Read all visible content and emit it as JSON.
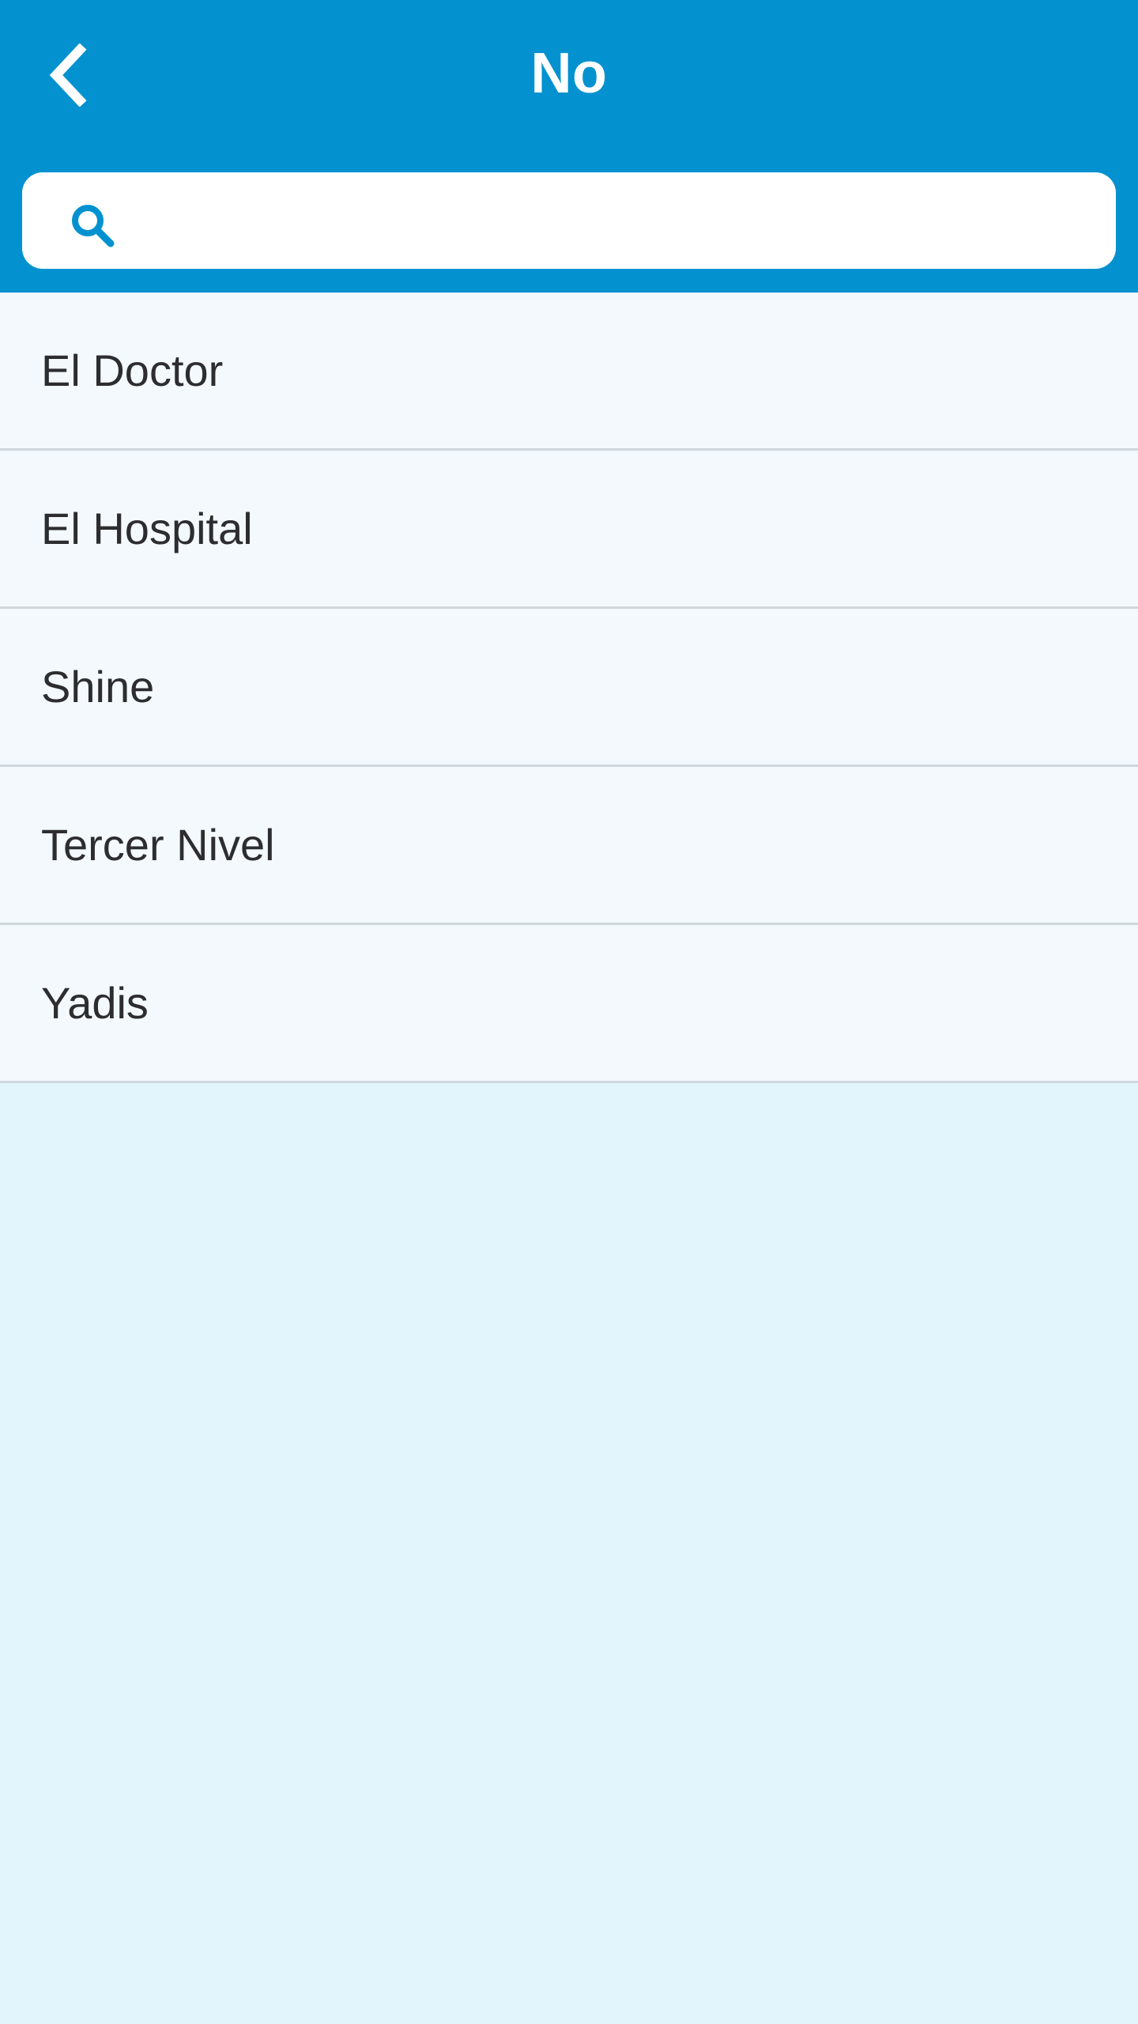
{
  "header": {
    "title": "No",
    "back_icon": "chevron-left-icon",
    "background_color": "#0392cf",
    "title_color": "#ffffff"
  },
  "search": {
    "icon": "search-icon",
    "value": "",
    "placeholder": ""
  },
  "list": {
    "items": [
      {
        "label": "El Doctor"
      },
      {
        "label": "El Hospital"
      },
      {
        "label": "Shine"
      },
      {
        "label": "Tercer Nivel"
      },
      {
        "label": "Yadis"
      }
    ]
  },
  "colors": {
    "accent": "#0392cf",
    "list_background": "#f3f9fd",
    "page_background": "#e2f4fc",
    "divider": "#cfd7dc",
    "text": "#2d2d2f"
  }
}
